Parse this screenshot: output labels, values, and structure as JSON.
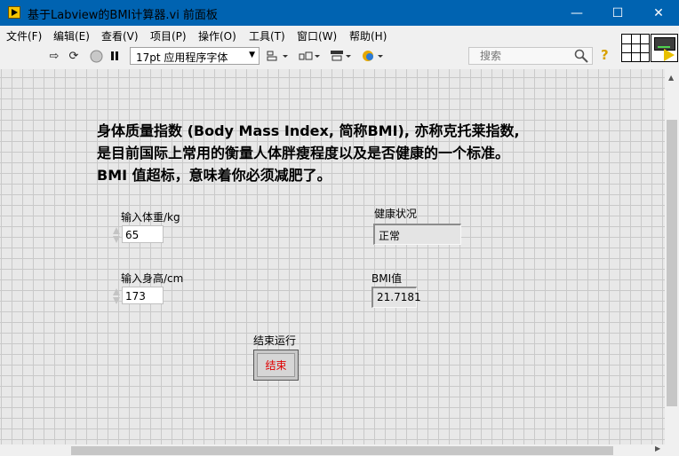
{
  "window": {
    "title": "基于Labview的BMI计算器.vi 前面板",
    "minimize": "—",
    "maximize": "☐",
    "close": "✕"
  },
  "menu": {
    "items": [
      {
        "label": "文件(F)"
      },
      {
        "label": "编辑(E)"
      },
      {
        "label": "查看(V)"
      },
      {
        "label": "项目(P)"
      },
      {
        "label": "操作(O)"
      },
      {
        "label": "工具(T)"
      },
      {
        "label": "窗口(W)"
      },
      {
        "label": "帮助(H)"
      }
    ]
  },
  "toolbar": {
    "font_select_value": "17pt 应用程序字体",
    "search_placeholder": "搜索",
    "icons": [
      "run-arrow-icon",
      "run-continuously-icon",
      "abort-icon",
      "pause-icon",
      "align-icon",
      "distribute-icon",
      "resize-icon",
      "reorder-icon",
      "search-icon",
      "help-icon"
    ]
  },
  "panel": {
    "description": [
      "身体质量指数 (Body Mass Index, 简称BMI), 亦称克托莱指数,",
      "是目前国际上常用的衡量人体胖瘦程度以及是否健康的一个标准。",
      "BMI 值超标，意味着你必须减肥了。"
    ],
    "weight": {
      "label": "输入体重/kg",
      "value": "65"
    },
    "height": {
      "label": "输入身高/cm",
      "value": "173"
    },
    "health": {
      "label": "健康状况",
      "value": "正常"
    },
    "bmi": {
      "label": "BMI值",
      "value": "21.7181"
    },
    "stop": {
      "label": "结束运行",
      "button_text": "结束"
    }
  },
  "colors": {
    "titlebar": "#0063b1",
    "stop_text": "#e00000",
    "panel_bg": "#e8e8e8",
    "grid": "#c9c9c9"
  }
}
